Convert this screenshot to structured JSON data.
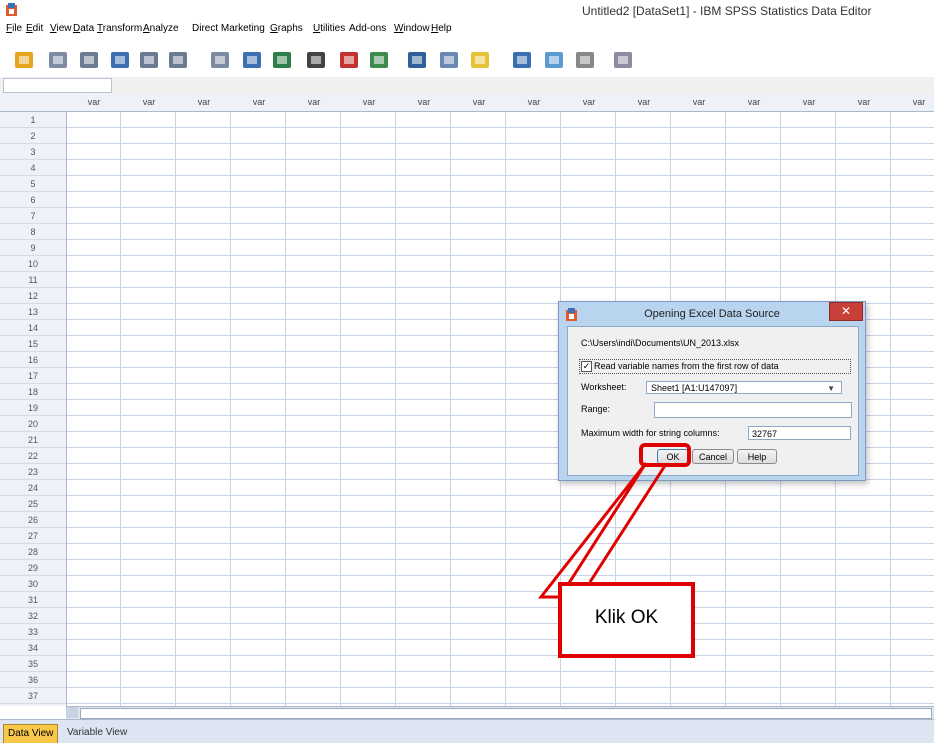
{
  "window": {
    "title": "Untitled2 [DataSet1] - IBM SPSS Statistics Data Editor"
  },
  "menu": [
    {
      "label": "File",
      "ul": "F",
      "rest": "ile"
    },
    {
      "label": "Edit",
      "ul": "E",
      "rest": "dit"
    },
    {
      "label": "View",
      "ul": "V",
      "rest": "iew"
    },
    {
      "label": "Data",
      "ul": "D",
      "rest": "ata"
    },
    {
      "label": "Transform",
      "ul": "T",
      "rest": "ransform"
    },
    {
      "label": "Analyze",
      "ul": "A",
      "rest": "nalyze"
    },
    {
      "label": "Direct Marketing",
      "ul": "",
      "rest": "Direct Marketing"
    },
    {
      "label": "Graphs",
      "ul": "G",
      "rest": "raphs"
    },
    {
      "label": "Utilities",
      "ul": "U",
      "rest": "tilities"
    },
    {
      "label": "Add-ons",
      "ul": "",
      "rest": "Add-ons"
    },
    {
      "label": "Window",
      "ul": "W",
      "rest": "indow"
    },
    {
      "label": "Help",
      "ul": "H",
      "rest": "elp"
    }
  ],
  "toolbar": {
    "icons": [
      "open-icon",
      "save-icon",
      "print-icon",
      "dialog-recall-icon",
      "undo-icon",
      "redo-icon",
      "goto-case-icon",
      "goto-variable-icon",
      "variables-icon",
      "find-icon",
      "insert-cases-icon",
      "insert-variable-icon",
      "split-file-icon",
      "weight-cases-icon",
      "select-cases-icon",
      "value-labels-icon",
      "use-sets-icon",
      "show-all-variables-icon",
      "spell-check-icon"
    ]
  },
  "grid": {
    "column_header": "var",
    "column_count": 16,
    "rows": [
      "1",
      "2",
      "3",
      "4",
      "5",
      "6",
      "7",
      "8",
      "9",
      "10",
      "11",
      "12",
      "13",
      "14",
      "15",
      "16",
      "17",
      "18",
      "19",
      "20",
      "21",
      "22",
      "23",
      "24",
      "25",
      "26",
      "27",
      "28",
      "29",
      "30",
      "31",
      "32",
      "33",
      "34",
      "35",
      "36",
      "37"
    ]
  },
  "tabs": {
    "data_view": "Data View",
    "variable_view": "Variable View"
  },
  "dialog": {
    "title": "Opening Excel Data Source",
    "file_path": "C:\\Users\\indi\\Documents\\UN_2013.xlsx",
    "read_names_label": "Read variable names from the first row of data",
    "read_names_checked": true,
    "worksheet_label": "Worksheet:",
    "worksheet_value": "Sheet1 [A1:U147097]",
    "range_label": "Range:",
    "range_value": "",
    "max_width_label": "Maximum width for string columns:",
    "max_width_value": "32767",
    "ok_label": "OK",
    "cancel_label": "Cancel",
    "help_label": "Help",
    "close_glyph": "✕"
  },
  "annotation": {
    "callout_text": "Klik OK",
    "color": "#e00000"
  },
  "colors": {
    "tab_active": "#f9c84a",
    "dialog_frame": "#b9d4ee",
    "grid_line": "#c9d5e5"
  }
}
